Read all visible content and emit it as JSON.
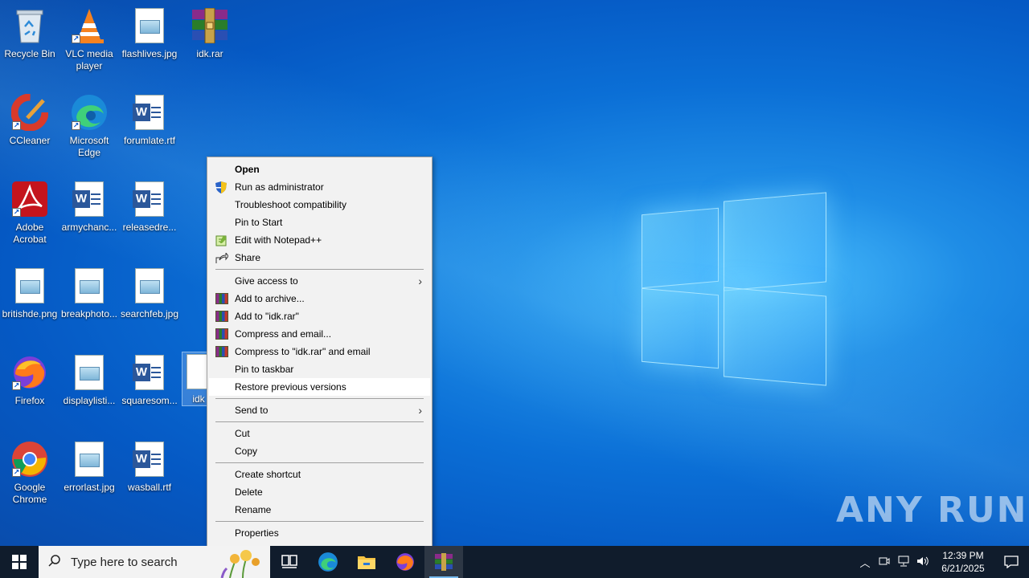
{
  "desktop": {
    "icons": [
      {
        "label": "Recycle Bin",
        "icon": "recycle-bin-icon"
      },
      {
        "label": "VLC media\nplayer",
        "icon": "vlc-icon"
      },
      {
        "label": "flashlives.jpg",
        "icon": "image-file-icon"
      },
      {
        "label": "idk.rar",
        "icon": "winrar-archive-icon"
      },
      {
        "label": "CCleaner",
        "icon": "ccleaner-icon"
      },
      {
        "label": "Microsoft\nEdge",
        "icon": "edge-icon"
      },
      {
        "label": "forumlate.rtf",
        "icon": "word-document-icon"
      },
      {
        "label": "Adobe\nAcrobat",
        "icon": "acrobat-icon"
      },
      {
        "label": "armychanc...",
        "icon": "word-document-icon"
      },
      {
        "label": "releasedre...",
        "icon": "word-document-icon"
      },
      {
        "label": "britishde.png",
        "icon": "image-file-icon"
      },
      {
        "label": "breakphoto...",
        "icon": "image-file-icon"
      },
      {
        "label": "searchfeb.jpg",
        "icon": "image-file-icon"
      },
      {
        "label": "Firefox",
        "icon": "firefox-icon"
      },
      {
        "label": "displaylisti...",
        "icon": "image-file-icon"
      },
      {
        "label": "squaresom...",
        "icon": "word-document-icon"
      },
      {
        "label": "idk",
        "icon": "file-icon"
      },
      {
        "label": "Google\nChrome",
        "icon": "chrome-icon"
      },
      {
        "label": "errorlast.jpg",
        "icon": "image-file-icon"
      },
      {
        "label": "wasball.rtf",
        "icon": "word-document-icon"
      }
    ]
  },
  "context_menu": {
    "items": [
      {
        "label": "Open"
      },
      {
        "label": "Run as administrator"
      },
      {
        "label": "Troubleshoot compatibility"
      },
      {
        "label": "Pin to Start"
      },
      {
        "label": "Edit with Notepad++"
      },
      {
        "label": "Share"
      },
      {
        "label": "Give access to"
      },
      {
        "label": "Add to archive..."
      },
      {
        "label": "Add to \"idk.rar\""
      },
      {
        "label": "Compress and email..."
      },
      {
        "label": "Compress to \"idk.rar\" and email"
      },
      {
        "label": "Pin to taskbar"
      },
      {
        "label": "Restore previous versions"
      },
      {
        "label": "Send to"
      },
      {
        "label": "Cut"
      },
      {
        "label": "Copy"
      },
      {
        "label": "Create shortcut"
      },
      {
        "label": "Delete"
      },
      {
        "label": "Rename"
      },
      {
        "label": "Properties"
      }
    ]
  },
  "taskbar": {
    "search_placeholder": "Type here to search",
    "clock_time": "12:39 PM",
    "clock_date": "6/21/2025",
    "apps": [
      "task-view-icon",
      "edge-icon",
      "file-explorer-icon",
      "firefox-icon",
      "winrar-icon"
    ]
  },
  "watermark": "ANY RUN",
  "colors": {
    "desktop_bg": "#0b6fd6",
    "menu_bg": "#f2f2f2",
    "taskbar_bg": "#101c2c",
    "selection": "#76b9ed"
  }
}
